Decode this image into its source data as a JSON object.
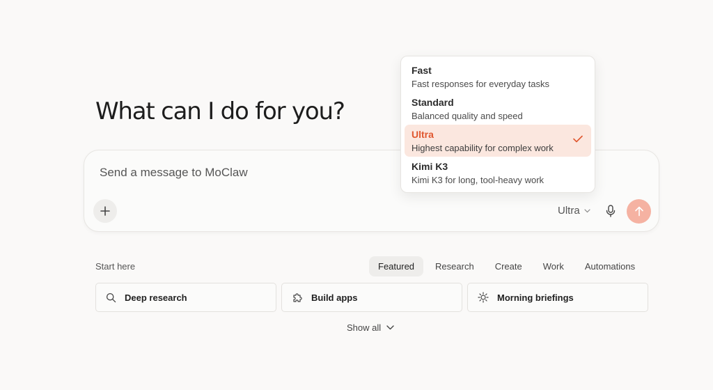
{
  "hero": {
    "title": "What can I do for you?"
  },
  "composer": {
    "placeholder": "Send a message to MoClaw",
    "model_label": "Ultra"
  },
  "model_menu": {
    "options": [
      {
        "title": "Fast",
        "description": "Fast responses for everyday tasks",
        "selected": false
      },
      {
        "title": "Standard",
        "description": "Balanced quality and speed",
        "selected": false
      },
      {
        "title": "Ultra",
        "description": "Highest capability for complex work",
        "selected": true
      },
      {
        "title": "Kimi K3",
        "description": "Kimi K3 for long, tool-heavy work",
        "selected": false
      }
    ]
  },
  "start": {
    "label": "Start here",
    "tabs": [
      "Featured",
      "Research",
      "Create",
      "Work",
      "Automations"
    ],
    "active_tab": "Featured",
    "cards": [
      {
        "label": "Deep research",
        "icon": "search-icon"
      },
      {
        "label": "Build apps",
        "icon": "puzzle-icon"
      },
      {
        "label": "Morning briefings",
        "icon": "sun-icon"
      }
    ],
    "show_all": "Show all"
  },
  "colors": {
    "accent": "#e0572f",
    "send_button": "#f5b2a2",
    "selected_option_bg": "#fbe7df",
    "background": "#faf9f8"
  }
}
